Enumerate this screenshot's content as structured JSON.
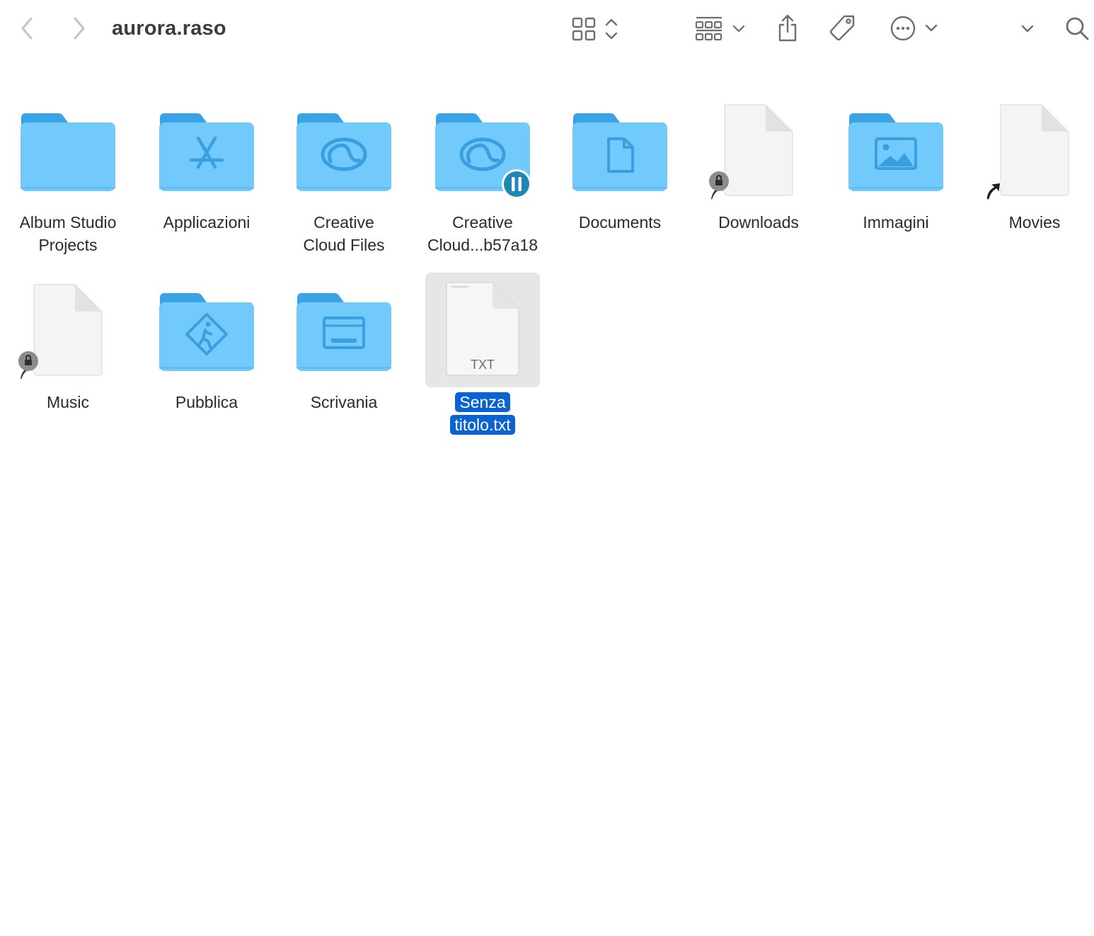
{
  "window": {
    "title": "aurora.raso",
    "toolbar": {
      "back_icon": "chevron-left-icon",
      "forward_icon": "chevron-right-icon",
      "view_icon": "icon-grid-view-icon",
      "group_icon": "group-by-icon",
      "share_icon": "share-icon",
      "tag_icon": "tag-icon",
      "more_icon": "ellipsis-circle-icon",
      "overflow_icon": "chevron-down-icon",
      "search_icon": "search-icon"
    }
  },
  "colors": {
    "folder_back": "#3aa3e6",
    "folder_front": "#72c9fb",
    "folder_glyph": "#3a9fe0",
    "selection": "#0a63d1",
    "sync_badge": "#1e88b4"
  },
  "items": [
    {
      "label": "Album Studio Projects",
      "line1": "Album Studio",
      "line2": "Projects",
      "kind": "folder",
      "glyph": "none"
    },
    {
      "label": "Applicazioni",
      "line1": "Applicazioni",
      "line2": "",
      "kind": "folder",
      "glyph": "app-store"
    },
    {
      "label": "Creative Cloud Files",
      "line1": "Creative",
      "line2": "Cloud Files",
      "kind": "folder",
      "glyph": "creative-cloud"
    },
    {
      "label": "Creative Cloud...b57a18",
      "line1": "Creative",
      "line2": "Cloud...b57a18",
      "kind": "folder",
      "glyph": "creative-cloud",
      "badge": "pause"
    },
    {
      "label": "Documents",
      "line1": "Documents",
      "line2": "",
      "kind": "folder",
      "glyph": "document"
    },
    {
      "label": "Downloads",
      "line1": "Downloads",
      "line2": "",
      "kind": "alias-doc",
      "badge": "lock"
    },
    {
      "label": "Immagini",
      "line1": "Immagini",
      "line2": "",
      "kind": "folder",
      "glyph": "photo"
    },
    {
      "label": "Movies",
      "line1": "Movies",
      "line2": "",
      "kind": "alias-doc",
      "badge": "arrow"
    },
    {
      "label": "Music",
      "line1": "Music",
      "line2": "",
      "kind": "alias-doc",
      "badge": "lock"
    },
    {
      "label": "Pubblica",
      "line1": "Pubblica",
      "line2": "",
      "kind": "folder",
      "glyph": "public"
    },
    {
      "label": "Scrivania",
      "line1": "Scrivania",
      "line2": "",
      "kind": "folder",
      "glyph": "desktop"
    },
    {
      "label": "Senza titolo.txt",
      "line1": "Senza",
      "line2": "titolo.txt",
      "kind": "txt",
      "file_type": "TXT",
      "selected": true
    }
  ]
}
